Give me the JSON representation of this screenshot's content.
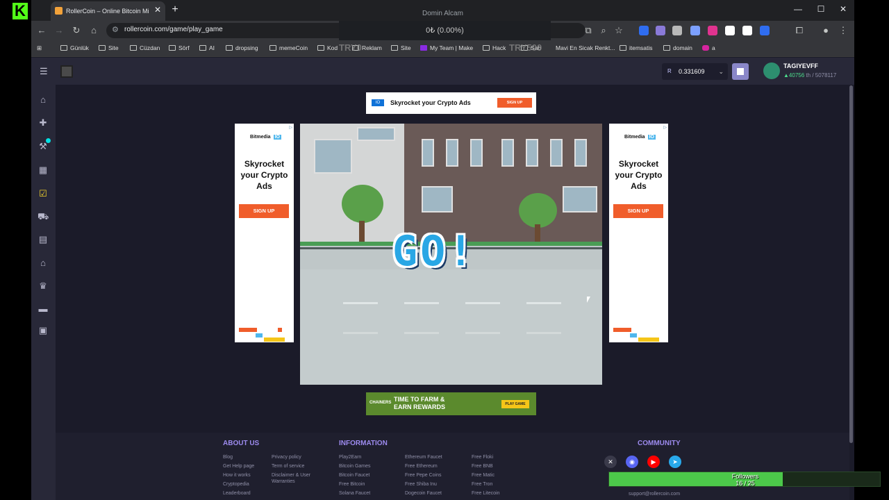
{
  "stream": {
    "logo": "K",
    "count": "0"
  },
  "browser": {
    "tab_title": "RollerCoin – Online Bitcoin Mi",
    "window_title": "Domin Alcam",
    "url": "rollercoin.com/game/play_game",
    "ticker": "0₺ (0.00%)",
    "overlay_left": "TRY0",
    "overlay_right": "TRY500"
  },
  "bookmarks": [
    "Günlük",
    "Site",
    "Cüzdan",
    "Sörf",
    "AI",
    "dropsing",
    "memeCoin",
    "Kod",
    "Reklam",
    "Site",
    "My Team | Make",
    "Hack",
    "Sab",
    "Mavi En Sicak Renkt...",
    "itemsatis",
    "domain",
    "a"
  ],
  "header": {
    "balance": "0.331609",
    "balance_currency_icon": "R",
    "username": "TAGIYEVFF",
    "rank": "40756",
    "rank_suffix": "th",
    "rank_total": "/ 5078117"
  },
  "sidebar_icons": [
    "home-icon",
    "gamepad-icon",
    "miner-icon",
    "calendar-icon",
    "tasks-icon",
    "cart-icon",
    "marketplace-icon",
    "storage-icon",
    "trophy-icon",
    "rack-icon",
    "wallet-icon"
  ],
  "ads": {
    "top_text": "Skyrocket your Crypto Ads",
    "top_button": "SIGN UP",
    "side_brand": "Bitmedia",
    "side_brand_tag": "IO",
    "side_headline": "Skyrocket your Crypto Ads",
    "side_button": "SIGN UP",
    "bottom_brand": "CHAINERS",
    "bottom_text": "TIME TO FARM & EARN REWARDS",
    "bottom_button": "PLAY GAME"
  },
  "game": {
    "banner": "GO!"
  },
  "footer": {
    "about_title": "ABOUT US",
    "about_links_col1": [
      "Blog",
      "Get Help page",
      "How it works",
      "Cryptopedia",
      "Leaderboard"
    ],
    "about_links_col2": [
      "Privacy policy",
      "Term of service",
      "Disclaimer & User Warranties"
    ],
    "info_title": "INFORMATION",
    "info_col1": [
      "Play2Earn",
      "Bitcoin Games",
      "Bitcoin Faucet",
      "Free Bitcoin",
      "Solana Faucet"
    ],
    "info_col2": [
      "Ethereum Faucet",
      "Free Ethereum",
      "Free Pepe Coins",
      "Free Shiba Inu",
      "Dogecoin Faucet"
    ],
    "info_col3": [
      "Free Floki",
      "Free BNB",
      "Free Matic",
      "Free Tron",
      "Free Litecoin"
    ],
    "community_title": "COMMUNITY",
    "support_email": "support@rollercoin.com"
  },
  "followers": {
    "label": "Followers",
    "count": "16 / 25",
    "progress": 0.64
  },
  "colors": {
    "accent": "#9d8bef",
    "go_blue": "#29a7e5",
    "signup_orange": "#f05d2b",
    "followers_green": "#4cc84a"
  }
}
